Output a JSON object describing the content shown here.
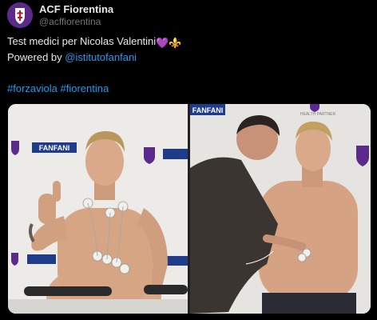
{
  "account": {
    "name": "ACF Fiorentina",
    "handle": "@acffiorentina"
  },
  "tweet": {
    "line1_text": "Test medici per Nicolas Valentini",
    "line1_emoji": "💜⚜️",
    "line2_prefix": "Powered by ",
    "line2_mention": "@istitutofanfani",
    "hashtag1": "#forzaviola",
    "hashtag2": "#fiorentina"
  },
  "media": {
    "photo1_brand": "FANFANI",
    "photo2_brand": "FANFANI",
    "backdrop_caption": "HEALTH PARTNER"
  },
  "colors": {
    "background": "#000000",
    "text": "#e7e9ea",
    "secondary_text": "#71767b",
    "link": "#1d9bf0",
    "brand_purple": "#5b2a8c"
  }
}
